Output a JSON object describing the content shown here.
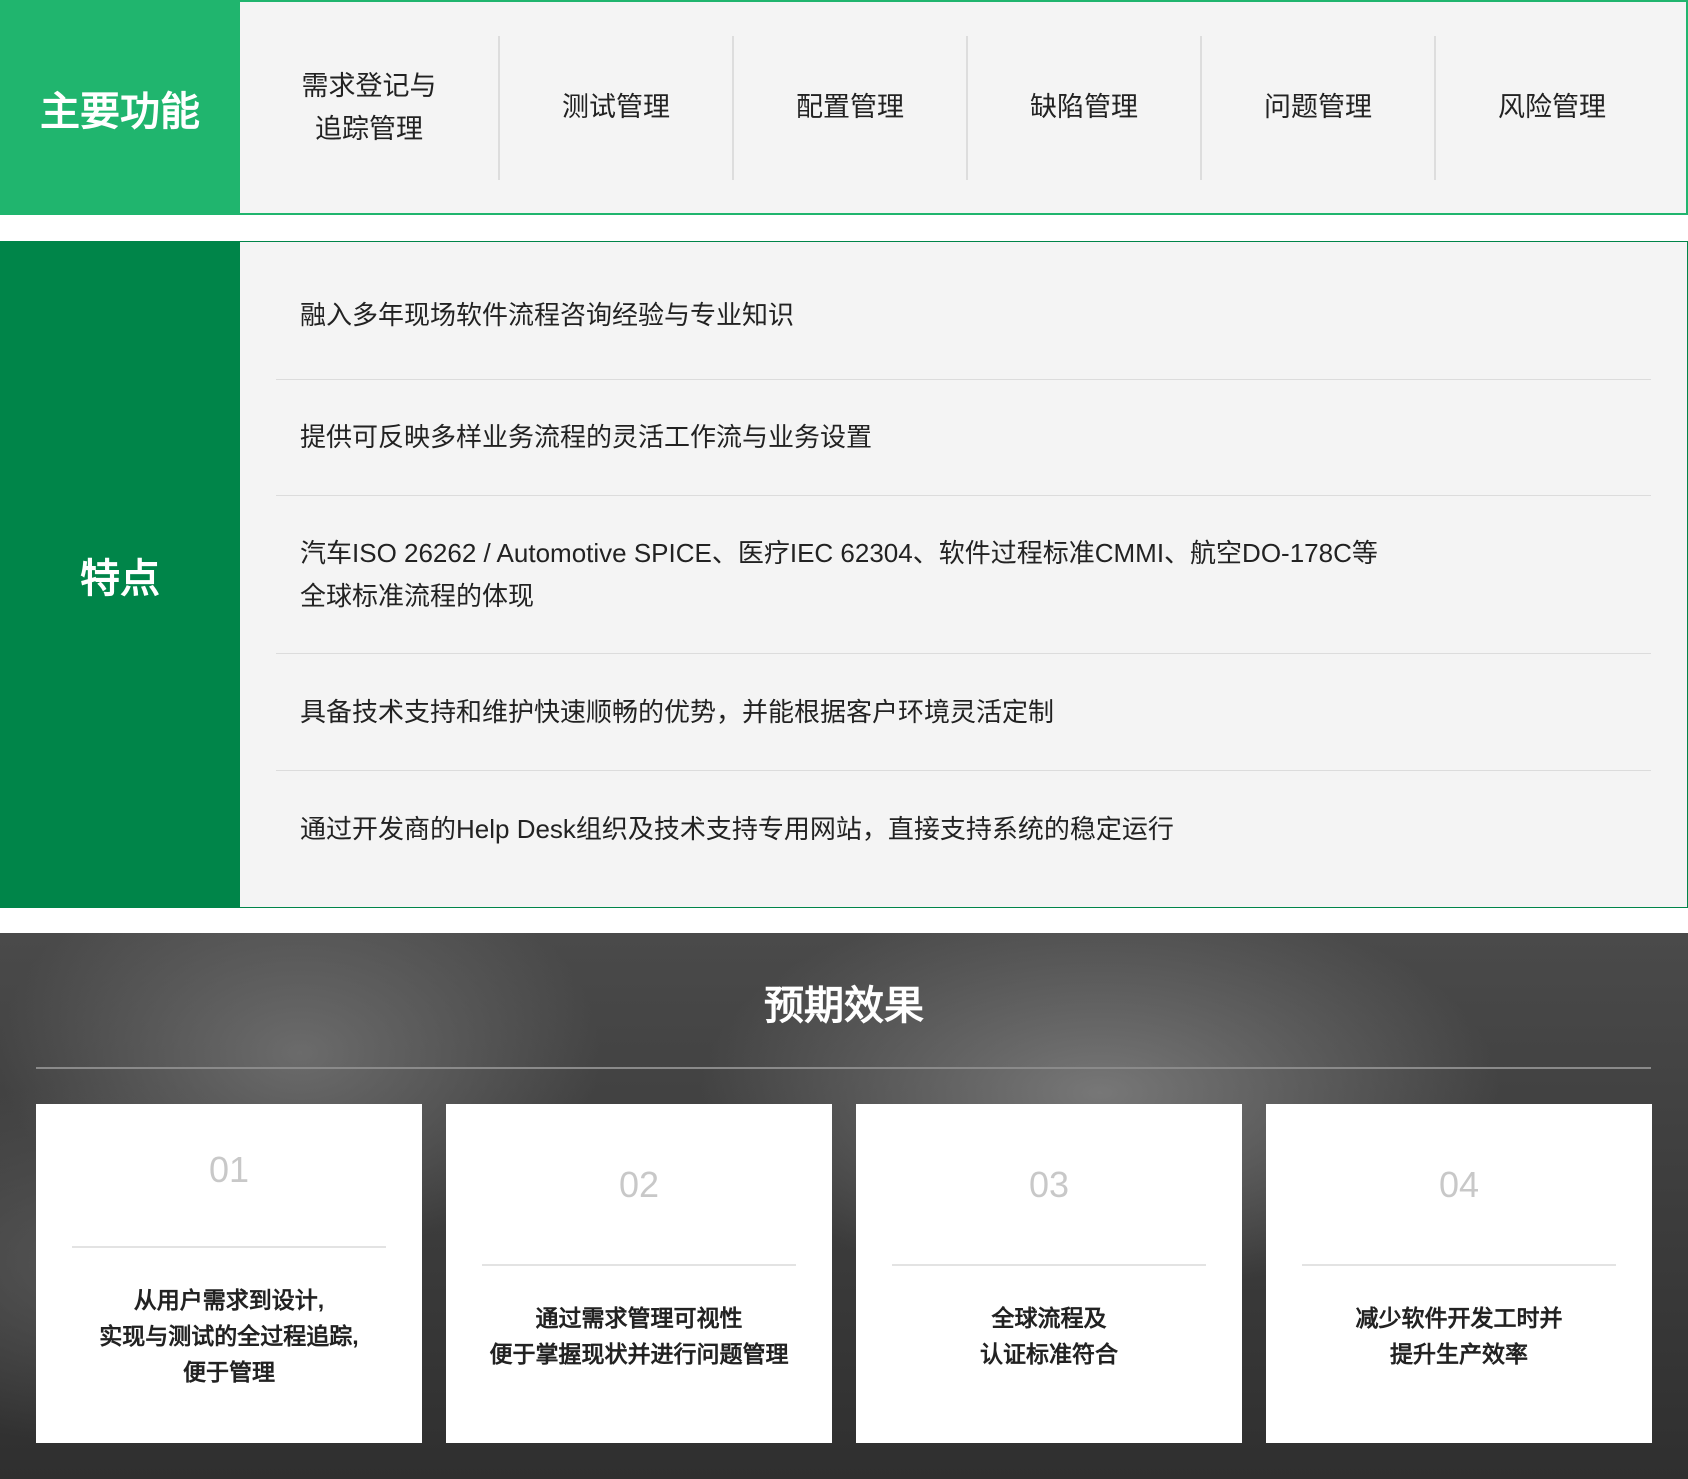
{
  "main_functions": {
    "label": "主要功能",
    "items": [
      [
        "需求登记与",
        "追踪管理"
      ],
      [
        "测试管理"
      ],
      [
        "配置管理"
      ],
      [
        "缺陷管理"
      ],
      [
        "问题管理"
      ],
      [
        "风险管理"
      ]
    ]
  },
  "features": {
    "label": "特点",
    "items": [
      [
        "融入多年现场软件流程咨询经验与专业知识"
      ],
      [
        "提供可反映多样业务流程的灵活工作流与业务设置"
      ],
      [
        "汽车ISO 26262 / Automotive SPICE、医疗IEC 62304、软件过程标准CMMI、航空DO-178C等",
        "全球标准流程的体现"
      ],
      [
        "具备技术支持和维护快速顺畅的优势，并能根据客户环境灵活定制"
      ],
      [
        "通过开发商的Help Desk组织及技术支持专用网站，直接支持系统的稳定运行"
      ]
    ]
  },
  "effects": {
    "title": "预期效果",
    "cards": [
      {
        "num": "01",
        "lines": [
          "从用户需求到设计,",
          "实现与测试的全过程追踪,",
          "便于管理"
        ]
      },
      {
        "num": "02",
        "lines": [
          "通过需求管理可视性",
          "便于掌握现状并进行问题管理"
        ]
      },
      {
        "num": "03",
        "lines": [
          "全球流程及",
          "认证标准符合"
        ]
      },
      {
        "num": "04",
        "lines": [
          "减少软件开发工时并",
          "提升生产效率"
        ]
      }
    ]
  }
}
